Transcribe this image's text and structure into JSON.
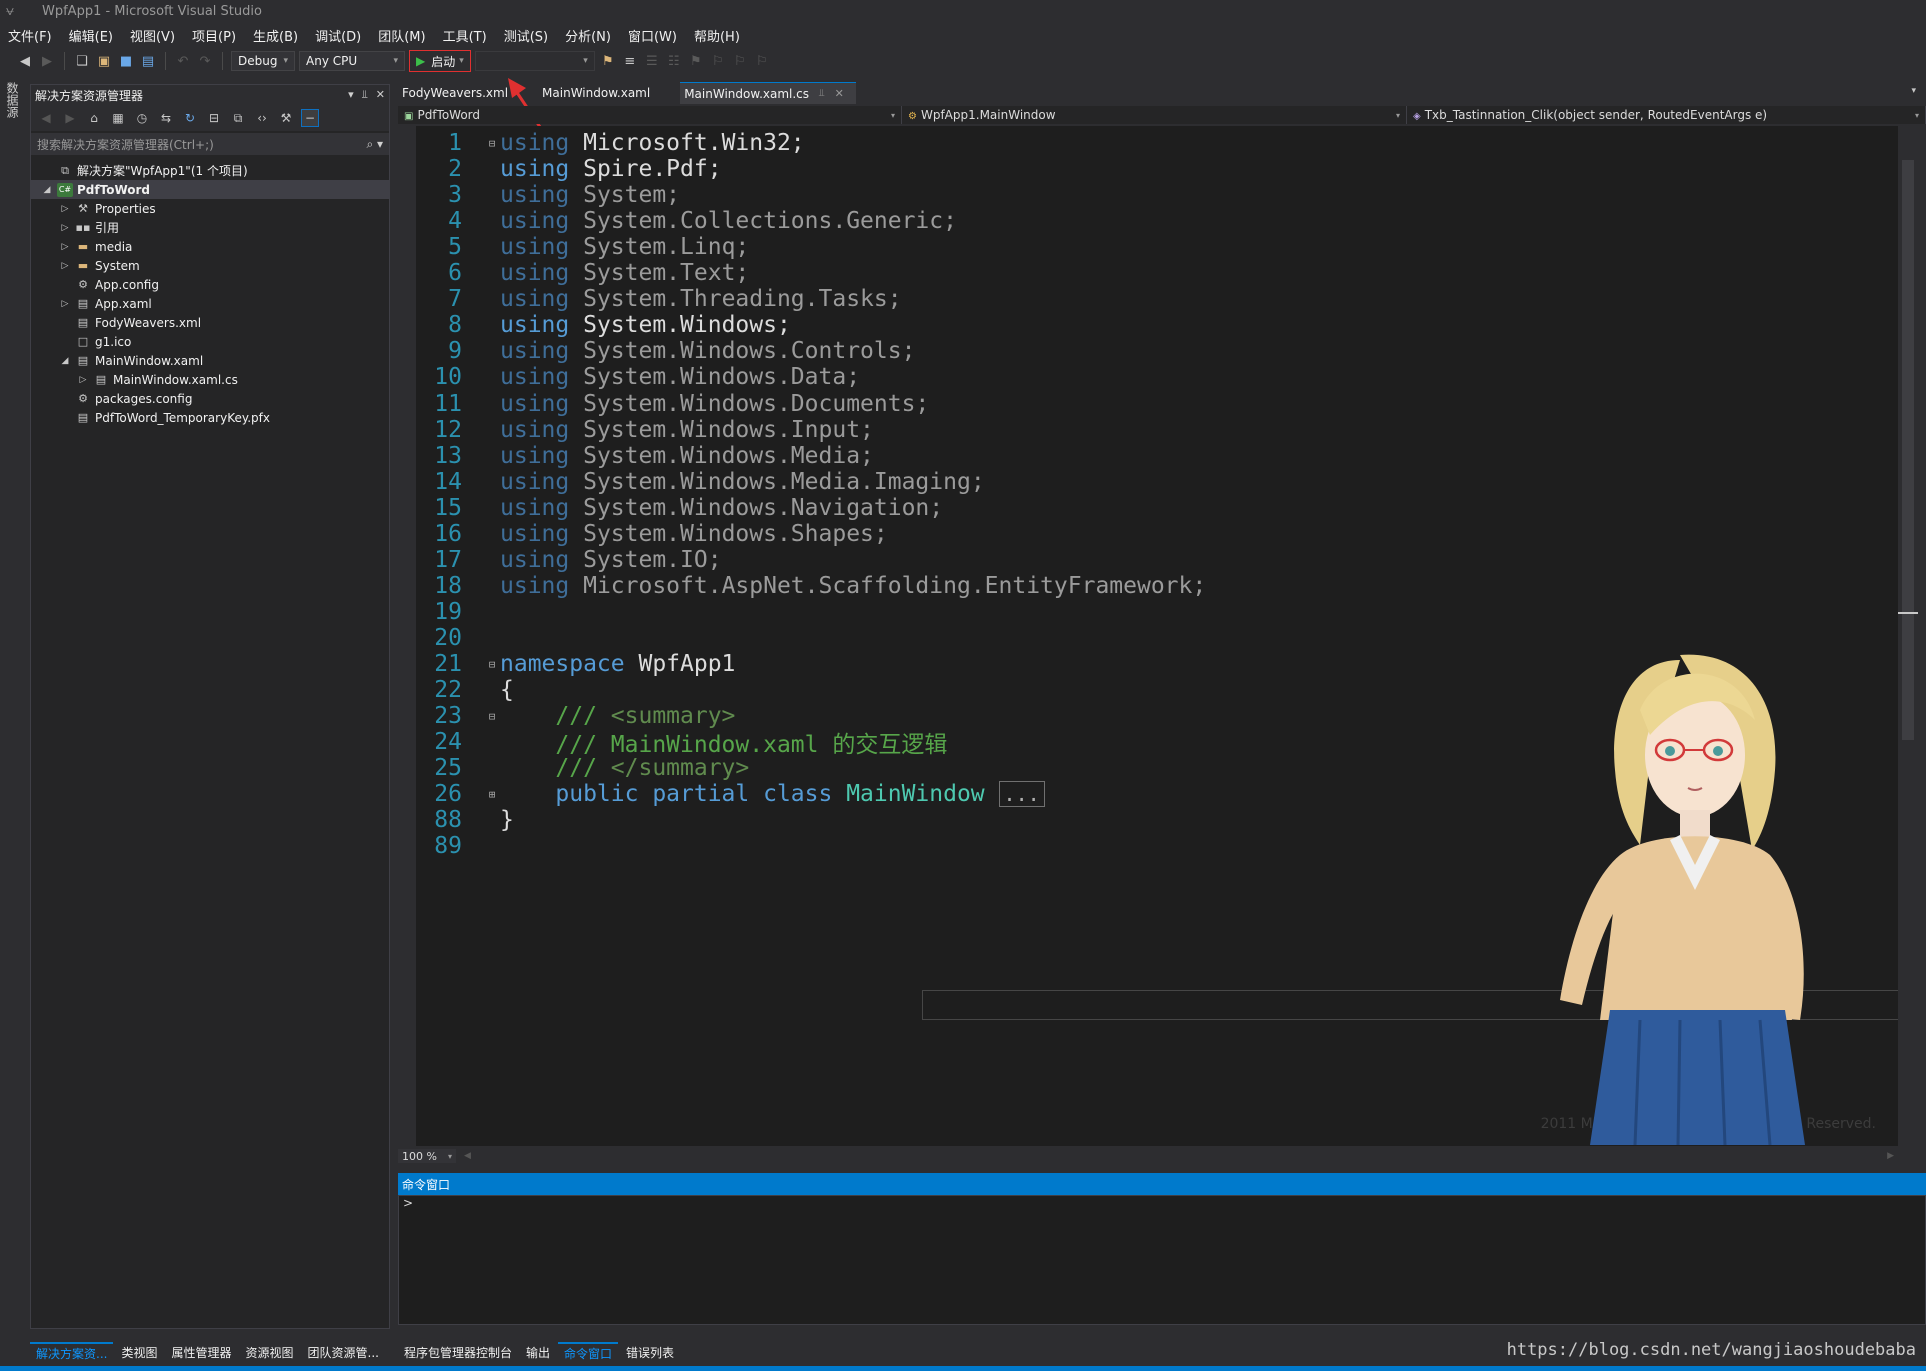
{
  "window": {
    "title": "WpfApp1 - Microsoft Visual Studio"
  },
  "menu": [
    "文件(F)",
    "编辑(E)",
    "视图(V)",
    "项目(P)",
    "生成(B)",
    "调试(D)",
    "团队(M)",
    "工具(T)",
    "测试(S)",
    "分析(N)",
    "窗口(W)",
    "帮助(H)"
  ],
  "toolbar": {
    "config": "Debug",
    "platform": "Any CPU",
    "start_label": "启动"
  },
  "left_strip": {
    "label": "数据源"
  },
  "solution_explorer": {
    "title": "解决方案资源管理器",
    "search_placeholder": "搜索解决方案资源管理器(Ctrl+;)",
    "items": [
      {
        "label": "解决方案\"WpfApp1\"(1 个项目)",
        "icon": "solution-icon",
        "expander": "",
        "indent": 0
      },
      {
        "label": "PdfToWord",
        "icon": "csharp-project-icon",
        "expander": "expanded",
        "indent": 0
      },
      {
        "label": "Properties",
        "icon": "wrench-icon",
        "expander": "collapsed",
        "indent": 1
      },
      {
        "label": "引用",
        "icon": "references-icon",
        "expander": "collapsed",
        "indent": 1
      },
      {
        "label": "media",
        "icon": "folder-icon",
        "expander": "collapsed",
        "indent": 1
      },
      {
        "label": "System",
        "icon": "folder-icon",
        "expander": "collapsed",
        "indent": 1
      },
      {
        "label": "App.config",
        "icon": "config-file-icon",
        "expander": "",
        "indent": 1
      },
      {
        "label": "App.xaml",
        "icon": "xaml-file-icon",
        "expander": "collapsed",
        "indent": 1
      },
      {
        "label": "FodyWeavers.xml",
        "icon": "xml-file-icon",
        "expander": "",
        "indent": 1
      },
      {
        "label": "g1.ico",
        "icon": "ico-file-icon",
        "expander": "",
        "indent": 1
      },
      {
        "label": "MainWindow.xaml",
        "icon": "xaml-file-icon",
        "expander": "expanded",
        "indent": 1
      },
      {
        "label": "MainWindow.xaml.cs",
        "icon": "cs-file-icon",
        "expander": "collapsed",
        "indent": 2
      },
      {
        "label": "packages.config",
        "icon": "config-file-icon",
        "expander": "",
        "indent": 1
      },
      {
        "label": "PdfToWord_TemporaryKey.pfx",
        "icon": "key-file-icon",
        "expander": "",
        "indent": 1
      }
    ]
  },
  "tabs": [
    {
      "label": "FodyWeavers.xml",
      "active": false
    },
    {
      "label": "MainWindow.xaml",
      "active": false
    },
    {
      "label": "MainWindow.xaml.cs",
      "active": true
    }
  ],
  "navbar": {
    "project": "PdfToWord",
    "type": "WpfApp1.MainWindow",
    "member": "Txb_Tastinnation_Clik(object sender, RoutedEventArgs e)"
  },
  "code": [
    {
      "n": "1",
      "fold": "minus",
      "parts": [
        [
          "kw-dim",
          "using"
        ],
        [
          "ns",
          " Microsoft.Win32;"
        ]
      ]
    },
    {
      "n": "2",
      "fold": "",
      "parts": [
        [
          "kw",
          "using"
        ],
        [
          "ns",
          " Spire.Pdf;"
        ]
      ]
    },
    {
      "n": "3",
      "fold": "",
      "parts": [
        [
          "kw-dim",
          "using"
        ],
        [
          "ns-dim",
          " System;"
        ]
      ]
    },
    {
      "n": "4",
      "fold": "",
      "parts": [
        [
          "kw-dim",
          "using"
        ],
        [
          "ns-dim",
          " System.Collections.Generic;"
        ]
      ]
    },
    {
      "n": "5",
      "fold": "",
      "parts": [
        [
          "kw-dim",
          "using"
        ],
        [
          "ns-dim",
          " System.Linq;"
        ]
      ]
    },
    {
      "n": "6",
      "fold": "",
      "parts": [
        [
          "kw-dim",
          "using"
        ],
        [
          "ns-dim",
          " System.Text;"
        ]
      ]
    },
    {
      "n": "7",
      "fold": "",
      "parts": [
        [
          "kw-dim",
          "using"
        ],
        [
          "ns-dim",
          " System.Threading.Tasks;"
        ]
      ]
    },
    {
      "n": "8",
      "fold": "",
      "parts": [
        [
          "kw",
          "using"
        ],
        [
          "ns",
          " System.Windows;"
        ]
      ]
    },
    {
      "n": "9",
      "fold": "",
      "parts": [
        [
          "kw-dim",
          "using"
        ],
        [
          "ns-dim",
          " System.Windows.Controls;"
        ]
      ]
    },
    {
      "n": "10",
      "fold": "",
      "parts": [
        [
          "kw-dim",
          "using"
        ],
        [
          "ns-dim",
          " System.Windows.Data;"
        ]
      ]
    },
    {
      "n": "11",
      "fold": "",
      "parts": [
        [
          "kw-dim",
          "using"
        ],
        [
          "ns-dim",
          " System.Windows.Documents;"
        ]
      ]
    },
    {
      "n": "12",
      "fold": "",
      "parts": [
        [
          "kw-dim",
          "using"
        ],
        [
          "ns-dim",
          " System.Windows.Input;"
        ]
      ]
    },
    {
      "n": "13",
      "fold": "",
      "parts": [
        [
          "kw-dim",
          "using"
        ],
        [
          "ns-dim",
          " System.Windows.Media;"
        ]
      ]
    },
    {
      "n": "14",
      "fold": "",
      "parts": [
        [
          "kw-dim",
          "using"
        ],
        [
          "ns-dim",
          " System.Windows.Media.Imaging;"
        ]
      ]
    },
    {
      "n": "15",
      "fold": "",
      "parts": [
        [
          "kw-dim",
          "using"
        ],
        [
          "ns-dim",
          " System.Windows.Navigation;"
        ]
      ]
    },
    {
      "n": "16",
      "fold": "",
      "parts": [
        [
          "kw-dim",
          "using"
        ],
        [
          "ns-dim",
          " System.Windows.Shapes;"
        ]
      ]
    },
    {
      "n": "17",
      "fold": "",
      "parts": [
        [
          "kw-dim",
          "using"
        ],
        [
          "ns-dim",
          " System.IO;"
        ]
      ]
    },
    {
      "n": "18",
      "fold": "",
      "parts": [
        [
          "kw-dim",
          "using"
        ],
        [
          "ns-dim",
          " Microsoft.AspNet.Scaffolding.EntityFramework;"
        ]
      ]
    },
    {
      "n": "19",
      "fold": "",
      "parts": []
    },
    {
      "n": "20",
      "fold": "",
      "parts": []
    },
    {
      "n": "21",
      "fold": "minus",
      "parts": [
        [
          "kw",
          "namespace"
        ],
        [
          "ns",
          " WpfApp1"
        ]
      ]
    },
    {
      "n": "22",
      "fold": "",
      "parts": [
        [
          "ns",
          "{"
        ]
      ]
    },
    {
      "n": "23",
      "fold": "minus",
      "parts": [
        [
          "cm",
          "    /// "
        ],
        [
          "cm-tag",
          "<summary>"
        ]
      ]
    },
    {
      "n": "24",
      "fold": "",
      "parts": [
        [
          "cm",
          "    /// MainWindow.xaml 的交互逻辑"
        ]
      ]
    },
    {
      "n": "25",
      "fold": "",
      "parts": [
        [
          "cm",
          "    /// "
        ],
        [
          "cm-tag",
          "</summary>"
        ]
      ]
    },
    {
      "n": "26",
      "fold": "plus",
      "parts": [
        [
          "kw",
          "    public partial class "
        ],
        [
          "type",
          "MainWindow"
        ],
        [
          "ns",
          " "
        ],
        [
          "box",
          "..."
        ]
      ]
    },
    {
      "n": "88",
      "fold": "",
      "parts": [
        [
          "ns",
          "}"
        ]
      ]
    },
    {
      "n": "89",
      "fold": "",
      "parts": []
    }
  ],
  "editor": {
    "watermark": "2011 Microsoft Corporation All Rights Reserved.",
    "zoom": "100 %"
  },
  "command_window": {
    "title": "命令窗口",
    "prompt": ">"
  },
  "bottom_left_tabs": [
    "解决方案资...",
    "类视图",
    "属性管理器",
    "资源视图",
    "团队资源管..."
  ],
  "bottom_right_tabs": [
    "程序包管理器控制台",
    "输出",
    "命令窗口",
    "错误列表"
  ],
  "url_watermark": "https://blog.csdn.net/wangjiaoshoudebaba",
  "colors": {
    "accent": "#007acc",
    "highlight_box": "#e03030"
  }
}
